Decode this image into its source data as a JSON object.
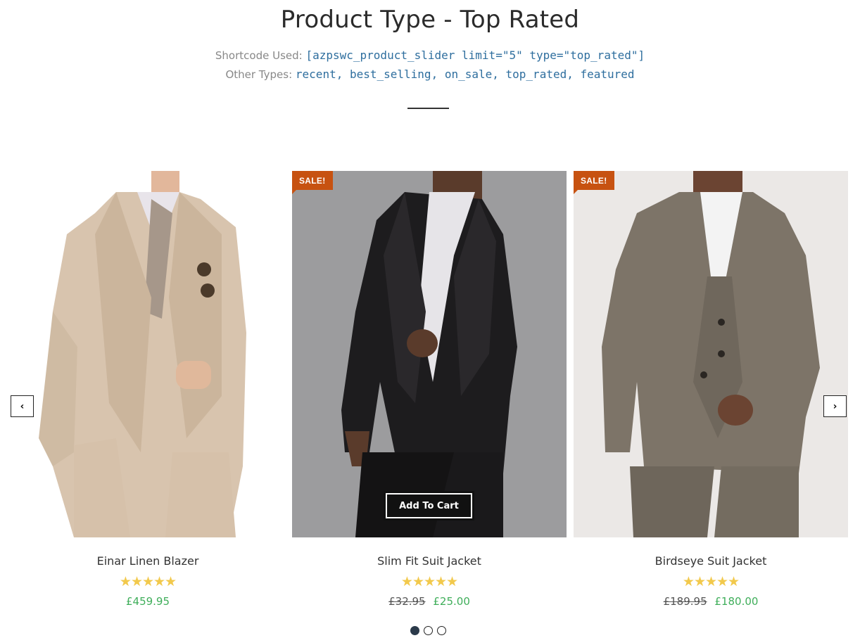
{
  "header": {
    "title": "Product Type - Top Rated",
    "shortcode_label": "Shortcode Used:",
    "shortcode_value": "[azpswc_product_slider limit=\"5\" type=\"top_rated\"]",
    "types_label": "Other Types:",
    "types_value": "recent, best_selling, on_sale, top_rated, featured"
  },
  "products": [
    {
      "name": "Einar Linen Blazer",
      "rating": 5,
      "stars": "★★★★★",
      "price": "£459.95",
      "old_price": "",
      "sale": ""
    },
    {
      "name": "Slim Fit Suit Jacket",
      "rating": 5,
      "stars": "★★★★★",
      "price": "£25.00",
      "old_price": "£32.95",
      "sale": "SALE!"
    },
    {
      "name": "Birdseye Suit Jacket",
      "rating": 5,
      "stars": "★★★★★",
      "price": "£180.00",
      "old_price": "£189.95",
      "sale": "SALE!"
    }
  ],
  "add_to_cart_label": "Add To Cart",
  "nav": {
    "prev_icon": "chevron-left-icon",
    "next_icon": "chevron-right-icon",
    "prev_glyph": "‹",
    "next_glyph": "›"
  },
  "pagination": {
    "pages": 3,
    "active": 1
  },
  "colors": {
    "sale_badge": "#c75211",
    "price_green": "#3fae5a",
    "star_gold": "#f2c94c",
    "code_blue": "#2e6e9e"
  }
}
